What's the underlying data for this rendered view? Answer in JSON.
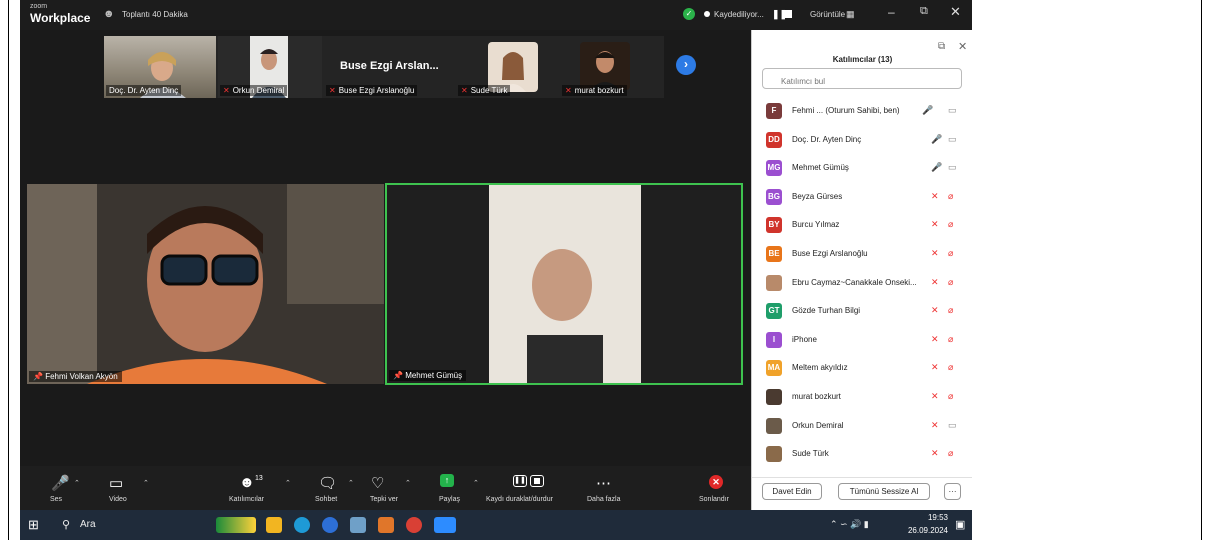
{
  "titlebar": {
    "logo_small": "zoom",
    "logo_big": "Workplace",
    "meeting_title": "Toplantı 40 Dakika",
    "recording_text": "Kaydediliyor...",
    "view_label": "Görüntüle"
  },
  "strip": {
    "thumbs": [
      {
        "name": "Doç. Dr. Ayten Dinç"
      },
      {
        "name": "Orkun Demiral"
      },
      {
        "name": "Buse Ezgi Arslanoğlu",
        "big_name": "Buse Ezgi Arslan..."
      },
      {
        "name": "Sude Türk"
      },
      {
        "name": "murat bozkurt"
      }
    ]
  },
  "tiles": {
    "tile1_name": "Fehmi Volkan Akyön",
    "tile2_name": "Mehmet Gümüş"
  },
  "sidebar": {
    "title": "Katılımcılar (13)",
    "search_placeholder": "Katılımcı bul",
    "participants": [
      {
        "initials": "F",
        "name": "Fehmi ... (Oturum Sahibi, ben)",
        "color": "#7a3b3b"
      },
      {
        "initials": "DD",
        "name": "Doç. Dr. Ayten Dinç",
        "color": "#d0342c"
      },
      {
        "initials": "MG",
        "name": "Mehmet Gümüş",
        "color": "#9b4fd0"
      },
      {
        "initials": "BG",
        "name": "Beyza Gürses",
        "color": "#9b4fd0"
      },
      {
        "initials": "BY",
        "name": "Burcu Yılmaz",
        "color": "#d0342c"
      },
      {
        "initials": "BE",
        "name": "Buse Ezgi Arslanoğlu",
        "color": "#e8751a"
      },
      {
        "initials": "",
        "name": "Ebru Caymaz~Canakkale Onseki...",
        "color": "#b88a6a"
      },
      {
        "initials": "GT",
        "name": "Gözde Turhan Bilgi",
        "color": "#1f9e6a"
      },
      {
        "initials": "I",
        "name": "iPhone",
        "color": "#9b4fd0"
      },
      {
        "initials": "MA",
        "name": "Meltem akyıldız",
        "color": "#f0a22a"
      },
      {
        "initials": "",
        "name": "murat bozkurt",
        "color": "#4a3a30"
      },
      {
        "initials": "",
        "name": "Orkun Demiral",
        "color": "#6b5b4a"
      },
      {
        "initials": "",
        "name": "Sude Türk",
        "color": "#8a6a4a"
      }
    ],
    "invite_label": "Davet Edin",
    "mute_all_label": "Tümünü Sessize Al",
    "more_label": "···"
  },
  "toolbar": {
    "audio_label": "Ses",
    "video_label": "Video",
    "participants_label": "Katılımcılar",
    "participants_count": "13",
    "chat_label": "Sohbet",
    "react_label": "Tepki ver",
    "share_label": "Paylaş",
    "record_label": "Kaydı duraklat/durdur",
    "more_label": "Daha fazla",
    "end_label": "Sonlandır"
  },
  "taskbar": {
    "search_label": "Ara",
    "time": "19:53",
    "date": "26.09.2024"
  }
}
